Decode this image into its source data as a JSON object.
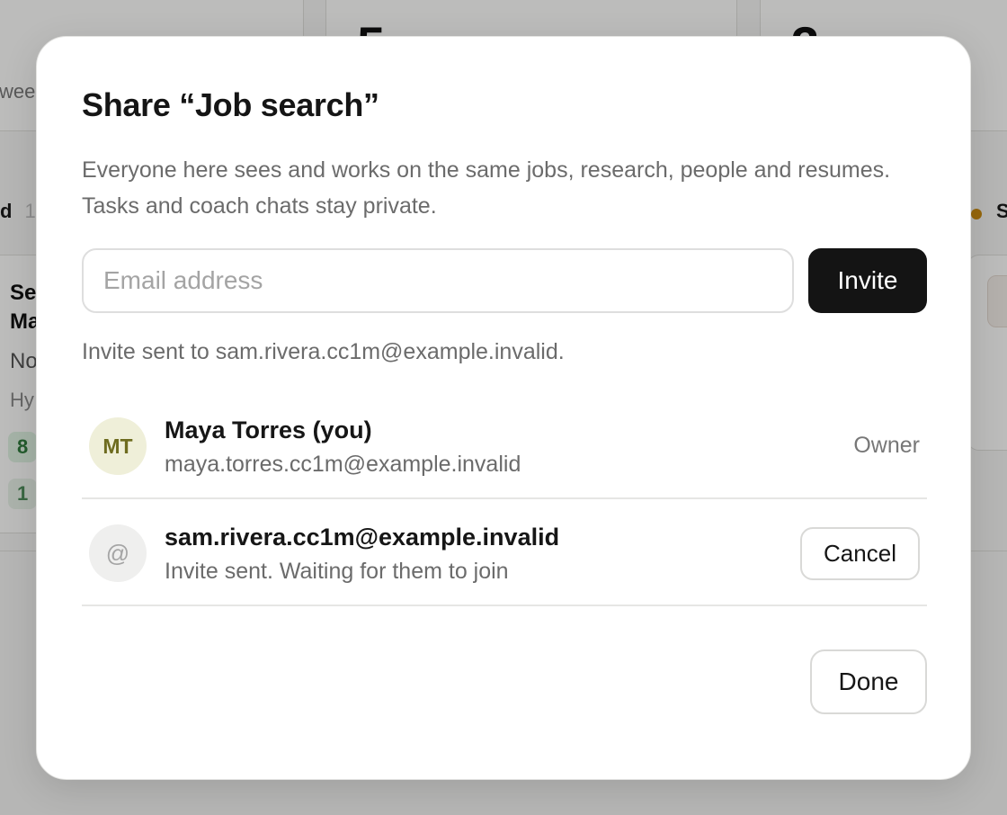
{
  "background": {
    "stat_cards": [
      {
        "value": "5"
      },
      {
        "value": "3"
      }
    ],
    "left_sub_text": "wee",
    "columns": [
      {
        "header": "d",
        "count": "1"
      },
      {
        "header": "S"
      }
    ],
    "job_card": {
      "title": "Se\nMa",
      "company": "No",
      "location": "Hy",
      "tag1": "8",
      "tag2": "1"
    }
  },
  "modal": {
    "title": "Share “Job search”",
    "description": "Everyone here sees and works on the same jobs, research, people and resumes. Tasks and coach chats stay private.",
    "email_placeholder": "Email address",
    "email_value": "",
    "invite_label": "Invite",
    "invite_status": "Invite sent to sam.rivera.cc1m@example.invalid.",
    "members": [
      {
        "initials": "MT",
        "name": "Maya Torres (you)",
        "email": "maya.torres.cc1m@example.invalid",
        "role": "Owner"
      },
      {
        "initials": "@",
        "name": "sam.rivera.cc1m@example.invalid",
        "status": "Invite sent. Waiting for them to join",
        "action_label": "Cancel"
      }
    ],
    "done_label": "Done"
  },
  "colors": {
    "primary_button": "#141414",
    "overlay": "rgba(0,0,0,0.25)",
    "avatar_owner_bg": "#efefd9",
    "pending_dot": "#c98a10"
  }
}
